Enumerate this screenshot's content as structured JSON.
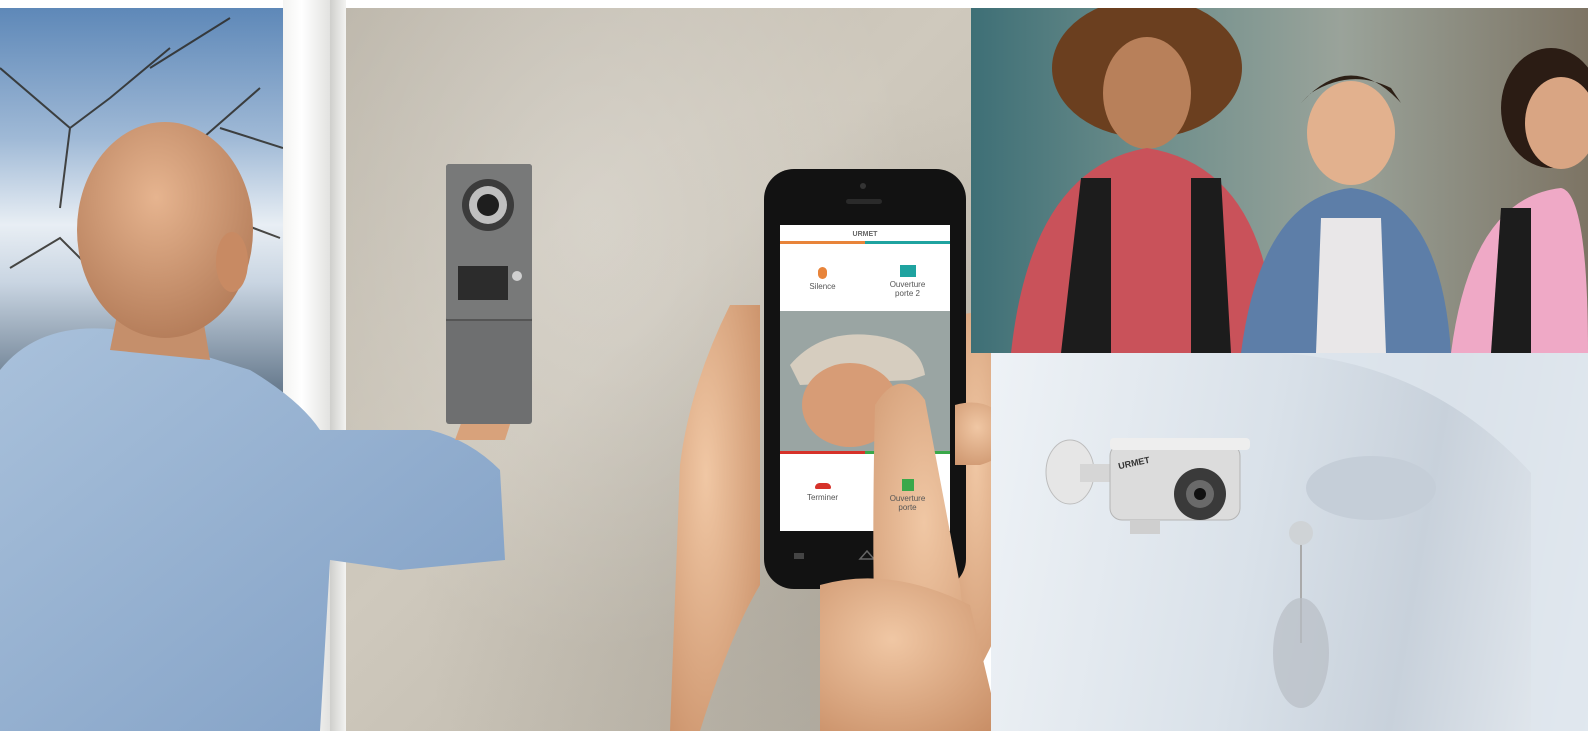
{
  "phone_app": {
    "brand": "URMET",
    "buttons": [
      {
        "label": "Silence",
        "icon": "microphone-muted-icon",
        "color": "#e8843a"
      },
      {
        "label": "Ouverture porte 2",
        "icon": "door-open-icon",
        "color": "#1fa3a0"
      },
      {
        "label": "Terminer",
        "icon": "phone-hangup-icon",
        "color": "#d6322a"
      },
      {
        "label": "Ouverture porte",
        "icon": "door-open-icon",
        "color": "#3aa84a"
      }
    ]
  },
  "camera_label": "URMET"
}
